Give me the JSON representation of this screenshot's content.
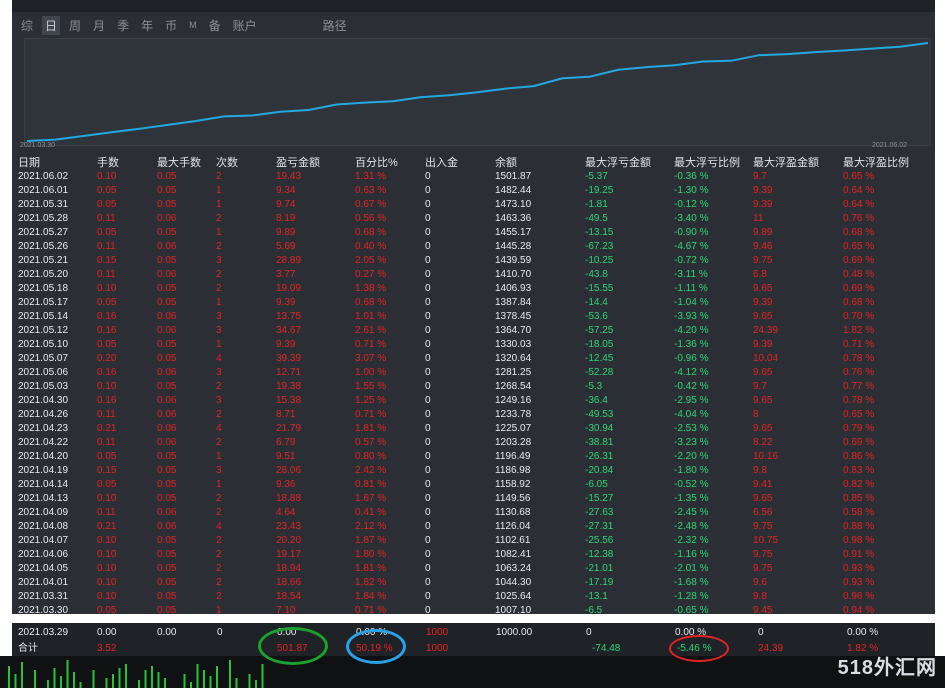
{
  "tabs": [
    "综",
    "日",
    "周",
    "月",
    "季",
    "年",
    "币",
    "M",
    "备",
    "账户",
    "路径"
  ],
  "active_tab": "日",
  "chart": {
    "start_label": "2021.03.30",
    "end_label": "2021.06.02",
    "line_color": "#22a7e0"
  },
  "columns": [
    "日期",
    "手数",
    "最大手数",
    "次数",
    "盈亏金额",
    "百分比%",
    "出入金",
    "余额",
    "最大浮亏金额",
    "最大浮亏比例",
    "最大浮盈金额",
    "最大浮盈比例"
  ],
  "rows": [
    [
      "2021.06.02",
      "0.10",
      "0.05",
      "2",
      "19.43",
      "1.31 %",
      "0",
      "1501.87",
      "-5.37",
      "-0.36 %",
      "9.7",
      "0.65 %"
    ],
    [
      "2021.06.01",
      "0.05",
      "0.05",
      "1",
      "9.34",
      "0.63 %",
      "0",
      "1482.44",
      "-19.25",
      "-1.30 %",
      "9.39",
      "0.64 %"
    ],
    [
      "2021.05.31",
      "0.05",
      "0.05",
      "1",
      "9.74",
      "0.67 %",
      "0",
      "1473.10",
      "-1.81",
      "-0.12 %",
      "9.39",
      "0.64 %"
    ],
    [
      "2021.05.28",
      "0.11",
      "0.06",
      "2",
      "8.19",
      "0.56 %",
      "0",
      "1463.36",
      "-49.5",
      "-3.40 %",
      "11",
      "0.76 %"
    ],
    [
      "2021.05.27",
      "0.05",
      "0.05",
      "1",
      "9.89",
      "0.68 %",
      "0",
      "1455.17",
      "-13.15",
      "-0.90 %",
      "9.89",
      "0.68 %"
    ],
    [
      "2021.05.26",
      "0.11",
      "0.06",
      "2",
      "5.69",
      "0.40 %",
      "0",
      "1445.28",
      "-67.23",
      "-4.67 %",
      "9.46",
      "0.65 %"
    ],
    [
      "2021.05.21",
      "0.15",
      "0.05",
      "3",
      "28.89",
      "2.05 %",
      "0",
      "1439.59",
      "-10.25",
      "-0.72 %",
      "9.75",
      "0.69 %"
    ],
    [
      "2021.05.20",
      "0.11",
      "0.06",
      "2",
      "3.77",
      "0.27 %",
      "0",
      "1410.70",
      "-43.8",
      "-3.11 %",
      "6.8",
      "0.48 %"
    ],
    [
      "2021.05.18",
      "0.10",
      "0.05",
      "2",
      "19.09",
      "1.38 %",
      "0",
      "1406.93",
      "-15.55",
      "-1.11 %",
      "9.65",
      "0.69 %"
    ],
    [
      "2021.05.17",
      "0.05",
      "0.05",
      "1",
      "9.39",
      "0.68 %",
      "0",
      "1387.84",
      "-14.4",
      "-1.04 %",
      "9.39",
      "0.68 %"
    ],
    [
      "2021.05.14",
      "0.16",
      "0.06",
      "3",
      "13.75",
      "1.01 %",
      "0",
      "1378.45",
      "-53.6",
      "-3.93 %",
      "9.65",
      "0.70 %"
    ],
    [
      "2021.05.12",
      "0.16",
      "0.06",
      "3",
      "34.67",
      "2.61 %",
      "0",
      "1364.70",
      "-57.25",
      "-4.20 %",
      "24.39",
      "1.82 %"
    ],
    [
      "2021.05.10",
      "0.05",
      "0.05",
      "1",
      "9.39",
      "0.71 %",
      "0",
      "1330.03",
      "-18.05",
      "-1.36 %",
      "9.39",
      "0.71 %"
    ],
    [
      "2021.05.07",
      "0.20",
      "0.05",
      "4",
      "39.39",
      "3.07 %",
      "0",
      "1320.64",
      "-12.45",
      "-0.96 %",
      "10.04",
      "0.78 %"
    ],
    [
      "2021.05.06",
      "0.16",
      "0.06",
      "3",
      "12.71",
      "1.00 %",
      "0",
      "1281.25",
      "-52.28",
      "-4.12 %",
      "9.65",
      "0.76 %"
    ],
    [
      "2021.05.03",
      "0.10",
      "0.05",
      "2",
      "19.38",
      "1.55 %",
      "0",
      "1268.54",
      "-5.3",
      "-0.42 %",
      "9.7",
      "0.77 %"
    ],
    [
      "2021.04.30",
      "0.16",
      "0.06",
      "3",
      "15.38",
      "1.25 %",
      "0",
      "1249.16",
      "-36.4",
      "-2.95 %",
      "9.65",
      "0.78 %"
    ],
    [
      "2021.04.26",
      "0.11",
      "0.06",
      "2",
      "8.71",
      "0.71 %",
      "0",
      "1233.78",
      "-49.53",
      "-4.04 %",
      "8",
      "0.65 %"
    ],
    [
      "2021.04.23",
      "0.21",
      "0.06",
      "4",
      "21.79",
      "1.81 %",
      "0",
      "1225.07",
      "-30.94",
      "-2.53 %",
      "9.65",
      "0.79 %"
    ],
    [
      "2021.04.22",
      "0.11",
      "0.06",
      "2",
      "6.79",
      "0.57 %",
      "0",
      "1203.28",
      "-38.81",
      "-3.23 %",
      "8.22",
      "0.69 %"
    ],
    [
      "2021.04.20",
      "0.05",
      "0.05",
      "1",
      "9.51",
      "0.80 %",
      "0",
      "1196.49",
      "-26.31",
      "-2.20 %",
      "10.16",
      "0.86 %"
    ],
    [
      "2021.04.19",
      "0.15",
      "0.05",
      "3",
      "28.06",
      "2.42 %",
      "0",
      "1186.98",
      "-20.84",
      "-1.80 %",
      "9.8",
      "0.83 %"
    ],
    [
      "2021.04.14",
      "0.05",
      "0.05",
      "1",
      "9.36",
      "0.81 %",
      "0",
      "1158.92",
      "-6.05",
      "-0.52 %",
      "9.41",
      "0.82 %"
    ],
    [
      "2021.04.13",
      "0.10",
      "0.05",
      "2",
      "18.88",
      "1.67 %",
      "0",
      "1149.56",
      "-15.27",
      "-1.35 %",
      "9.65",
      "0.85 %"
    ],
    [
      "2021.04.09",
      "0.11",
      "0.06",
      "2",
      "4.64",
      "0.41 %",
      "0",
      "1130.68",
      "-27.63",
      "-2.45 %",
      "6.56",
      "0.58 %"
    ],
    [
      "2021.04.08",
      "0.21",
      "0.06",
      "4",
      "23.43",
      "2.12 %",
      "0",
      "1126.04",
      "-27.31",
      "-2.48 %",
      "9.75",
      "0.88 %"
    ],
    [
      "2021.04.07",
      "0.10",
      "0.05",
      "2",
      "20.20",
      "1.87 %",
      "0",
      "1102.61",
      "-25.56",
      "-2.32 %",
      "10.75",
      "0.98 %"
    ],
    [
      "2021.04.06",
      "0.10",
      "0.05",
      "2",
      "19.17",
      "1.80 %",
      "0",
      "1082.41",
      "-12.38",
      "-1.16 %",
      "9.75",
      "0.91 %"
    ],
    [
      "2021.04.05",
      "0.10",
      "0.05",
      "2",
      "18.94",
      "1.81 %",
      "0",
      "1063.24",
      "-21.01",
      "-2.01 %",
      "9.75",
      "0.93 %"
    ],
    [
      "2021.04.01",
      "0.10",
      "0.05",
      "2",
      "18.66",
      "1.82 %",
      "0",
      "1044.30",
      "-17.19",
      "-1.68 %",
      "9.6",
      "0.93 %"
    ],
    [
      "2021.03.31",
      "0.10",
      "0.05",
      "2",
      "18.54",
      "1.84 %",
      "0",
      "1025.64",
      "-13.1",
      "-1.28 %",
      "9.8",
      "0.96 %"
    ],
    [
      "2021.03.30",
      "0.05",
      "0.05",
      "1",
      "7.10",
      "0.71 %",
      "0",
      "1007.10",
      "-6.5",
      "-0.65 %",
      "9.45",
      "0.94 %"
    ]
  ],
  "summary": {
    "row1": {
      "date": "2021.03.29",
      "lots": "0.00",
      "max_lots": "0.00",
      "count": "0",
      "pnl": "0.00",
      "pct": "0.00 %",
      "io": "1000",
      "balance": "1000.00",
      "max_float_loss": "0",
      "max_float_loss_pct": "0.00 %",
      "max_float_profit": "0",
      "max_float_profit_pct": "0.00 %"
    },
    "row2": {
      "label": "合计",
      "lots": "3.52",
      "pnl": "501.87",
      "pct": "50.19 %",
      "io": "1000",
      "max_float_loss": "-74.48",
      "max_float_loss_pct": "-5.46 %",
      "max_float_profit": "24.39",
      "max_float_profit_pct": "1.82 %"
    }
  },
  "annotation_colors": {
    "green": "#1aa22a",
    "blue": "#2aa0e6",
    "red": "#e32222"
  },
  "watermark": "518外汇网"
}
